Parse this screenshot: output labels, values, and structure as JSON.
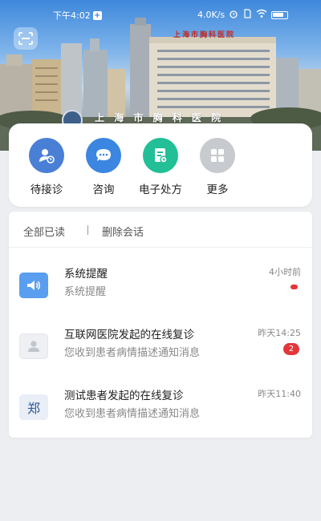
{
  "status_bar": {
    "time": "下午4:02",
    "net_speed": "4.0K/s",
    "icons": [
      "notification-plus-icon",
      "alarm-icon",
      "sim-icon",
      "wifi-icon",
      "battery-icon"
    ]
  },
  "hero": {
    "hospital_name": "上 海 市 胸 科 医 院",
    "building_sign": "上海市胸科医院",
    "scan_icon": "scan-icon"
  },
  "actions": [
    {
      "label": "待接诊",
      "icon": "patient-wait-icon",
      "color": "#4a7fd6"
    },
    {
      "label": "咨询",
      "icon": "chat-bubble-icon",
      "color": "#3b86e0"
    },
    {
      "label": "电子处方",
      "icon": "prescription-icon",
      "color": "#23bf96"
    },
    {
      "label": "更多",
      "icon": "grid-more-icon",
      "color": "#b8bcc2"
    }
  ],
  "messages_toolbar": {
    "mark_all_read": "全部已读",
    "delete_sessions": "删除会话"
  },
  "messages": [
    {
      "title": "系统提醒",
      "subtitle": "系统提醒",
      "time": "4小时前",
      "badge": "dot",
      "avatar": "speaker-icon"
    },
    {
      "title": "互联网医院发起的在线复诊",
      "subtitle": "您收到患者病情描述通知消息",
      "time": "昨天14:25",
      "badge": "2",
      "avatar": "user-icon"
    },
    {
      "title": "测试患者发起的在线复诊",
      "subtitle": "您收到患者病情描述通知消息",
      "time": "昨天11:40",
      "badge": "",
      "avatar": "郑"
    }
  ],
  "colors": {
    "accent": "#4a7fd6",
    "badge_red": "#e2363a",
    "background": "#eceef1"
  }
}
